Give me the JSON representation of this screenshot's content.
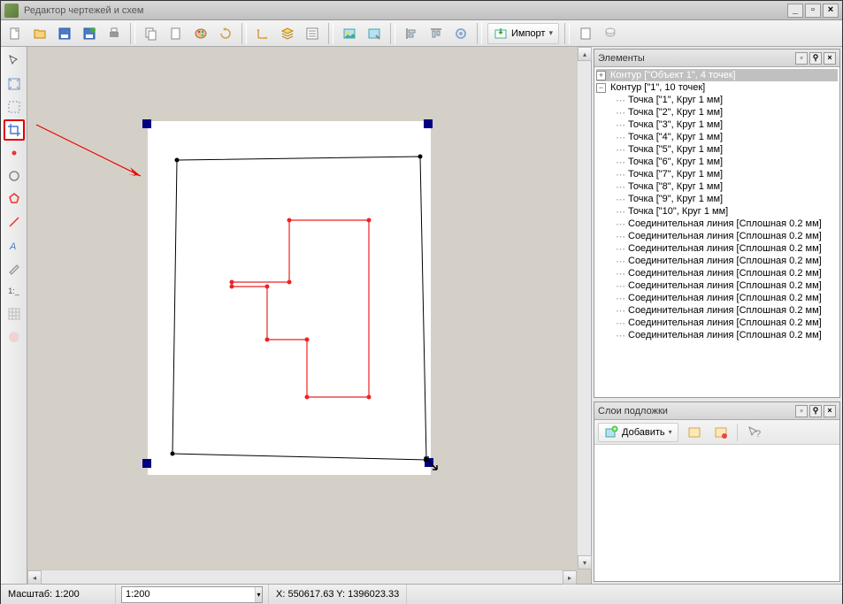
{
  "title": "Редактор чертежей и схем",
  "toolbar": {
    "import_label": "Импорт"
  },
  "panels": {
    "elements_title": "Элементы",
    "layers_title": "Слои подложки",
    "add_label": "Добавить"
  },
  "tree": {
    "root1": "Контур [\"Объект 1\", 4 точек]",
    "root2": "Контур [\"1\", 10 точек]",
    "points": [
      "Точка [\"1\", Круг 1 мм]",
      "Точка [\"2\", Круг 1 мм]",
      "Точка [\"3\", Круг 1 мм]",
      "Точка [\"4\", Круг 1 мм]",
      "Точка [\"5\", Круг 1 мм]",
      "Точка [\"6\", Круг 1 мм]",
      "Точка [\"7\", Круг 1 мм]",
      "Точка [\"8\", Круг 1 мм]",
      "Точка [\"9\", Круг 1 мм]",
      "Точка [\"10\", Круг 1 мм]"
    ],
    "lines": [
      "Соединительная линия [Сплошная 0.2 мм]",
      "Соединительная линия [Сплошная 0.2 мм]",
      "Соединительная линия [Сплошная 0.2 мм]",
      "Соединительная линия [Сплошная 0.2 мм]",
      "Соединительная линия [Сплошная 0.2 мм]",
      "Соединительная линия [Сплошная 0.2 мм]",
      "Соединительная линия [Сплошная 0.2 мм]",
      "Соединительная линия [Сплошная 0.2 мм]",
      "Соединительная линия [Сплошная 0.2 мм]",
      "Соединительная линия [Сплошная 0.2 мм]"
    ]
  },
  "status": {
    "scale_label": "Масштаб: 1:200",
    "zoom_value": "1:200",
    "coords": "X: 550617.63 Y: 1396023.33"
  }
}
